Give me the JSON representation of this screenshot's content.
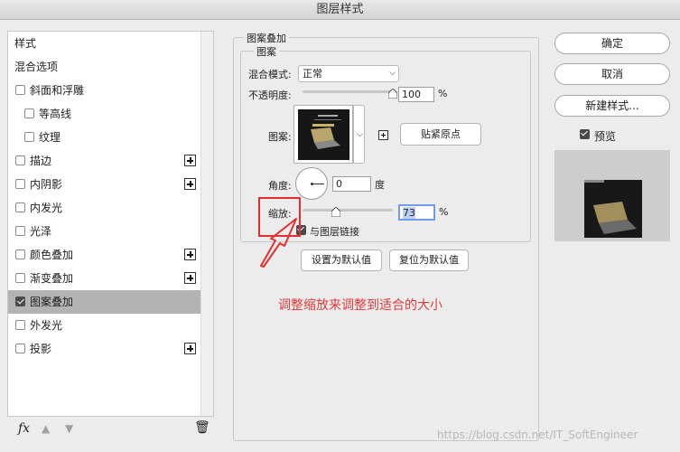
{
  "window": {
    "title": "图层样式"
  },
  "sidebar": {
    "items": [
      {
        "label": "样式",
        "checkbox": false,
        "checked": false,
        "plus": false,
        "selected": false,
        "indent": false
      },
      {
        "label": "混合选项",
        "checkbox": false,
        "checked": false,
        "plus": false,
        "selected": false,
        "indent": false
      },
      {
        "label": "斜面和浮雕",
        "checkbox": true,
        "checked": false,
        "plus": false,
        "selected": false,
        "indent": false
      },
      {
        "label": "等高线",
        "checkbox": true,
        "checked": false,
        "plus": false,
        "selected": false,
        "indent": true
      },
      {
        "label": "纹理",
        "checkbox": true,
        "checked": false,
        "plus": false,
        "selected": false,
        "indent": true
      },
      {
        "label": "描边",
        "checkbox": true,
        "checked": false,
        "plus": true,
        "selected": false,
        "indent": false
      },
      {
        "label": "内阴影",
        "checkbox": true,
        "checked": false,
        "plus": true,
        "selected": false,
        "indent": false
      },
      {
        "label": "内发光",
        "checkbox": true,
        "checked": false,
        "plus": false,
        "selected": false,
        "indent": false
      },
      {
        "label": "光泽",
        "checkbox": true,
        "checked": false,
        "plus": false,
        "selected": false,
        "indent": false
      },
      {
        "label": "颜色叠加",
        "checkbox": true,
        "checked": false,
        "plus": true,
        "selected": false,
        "indent": false
      },
      {
        "label": "渐变叠加",
        "checkbox": true,
        "checked": false,
        "plus": true,
        "selected": false,
        "indent": false
      },
      {
        "label": "图案叠加",
        "checkbox": true,
        "checked": true,
        "plus": false,
        "selected": true,
        "indent": false
      },
      {
        "label": "外发光",
        "checkbox": true,
        "checked": false,
        "plus": false,
        "selected": false,
        "indent": false
      },
      {
        "label": "投影",
        "checkbox": true,
        "checked": false,
        "plus": true,
        "selected": false,
        "indent": false
      }
    ],
    "footer": {
      "fx_label": "fx",
      "up_icon": "▲",
      "down_icon": "▼",
      "trash_icon": "🗑"
    }
  },
  "panel": {
    "group_title": "图案叠加",
    "subgroup_title": "图案",
    "blend_mode_label": "混合模式:",
    "blend_mode_value": "正常",
    "opacity_label": "不透明度:",
    "opacity_value": "100",
    "opacity_unit": "%",
    "opacity_level": 1.0,
    "pattern_label": "图案:",
    "snap_origin_button": "贴紧原点",
    "angle_label": "角度:",
    "angle_value": "0",
    "angle_unit": "度",
    "scale_label": "缩放:",
    "scale_value": "73",
    "scale_unit": "%",
    "scale_level": 0.73,
    "link_label": "与图层链接",
    "link_checked": true,
    "set_default_button": "设置为默认值",
    "reset_default_button": "复位为默认值"
  },
  "actions": {
    "ok": "确定",
    "cancel": "取消",
    "new_style": "新建样式...",
    "preview_label": "预览",
    "preview_checked": true
  },
  "annotation": {
    "text": "调整缩放来调整到适合的大小",
    "color": "#e23030"
  },
  "watermark": "https://blog.csdn.net/IT_SoftEngineer",
  "colors": {
    "selection": "#b3b3b3",
    "accent_highlight": "#6f9ee6"
  }
}
